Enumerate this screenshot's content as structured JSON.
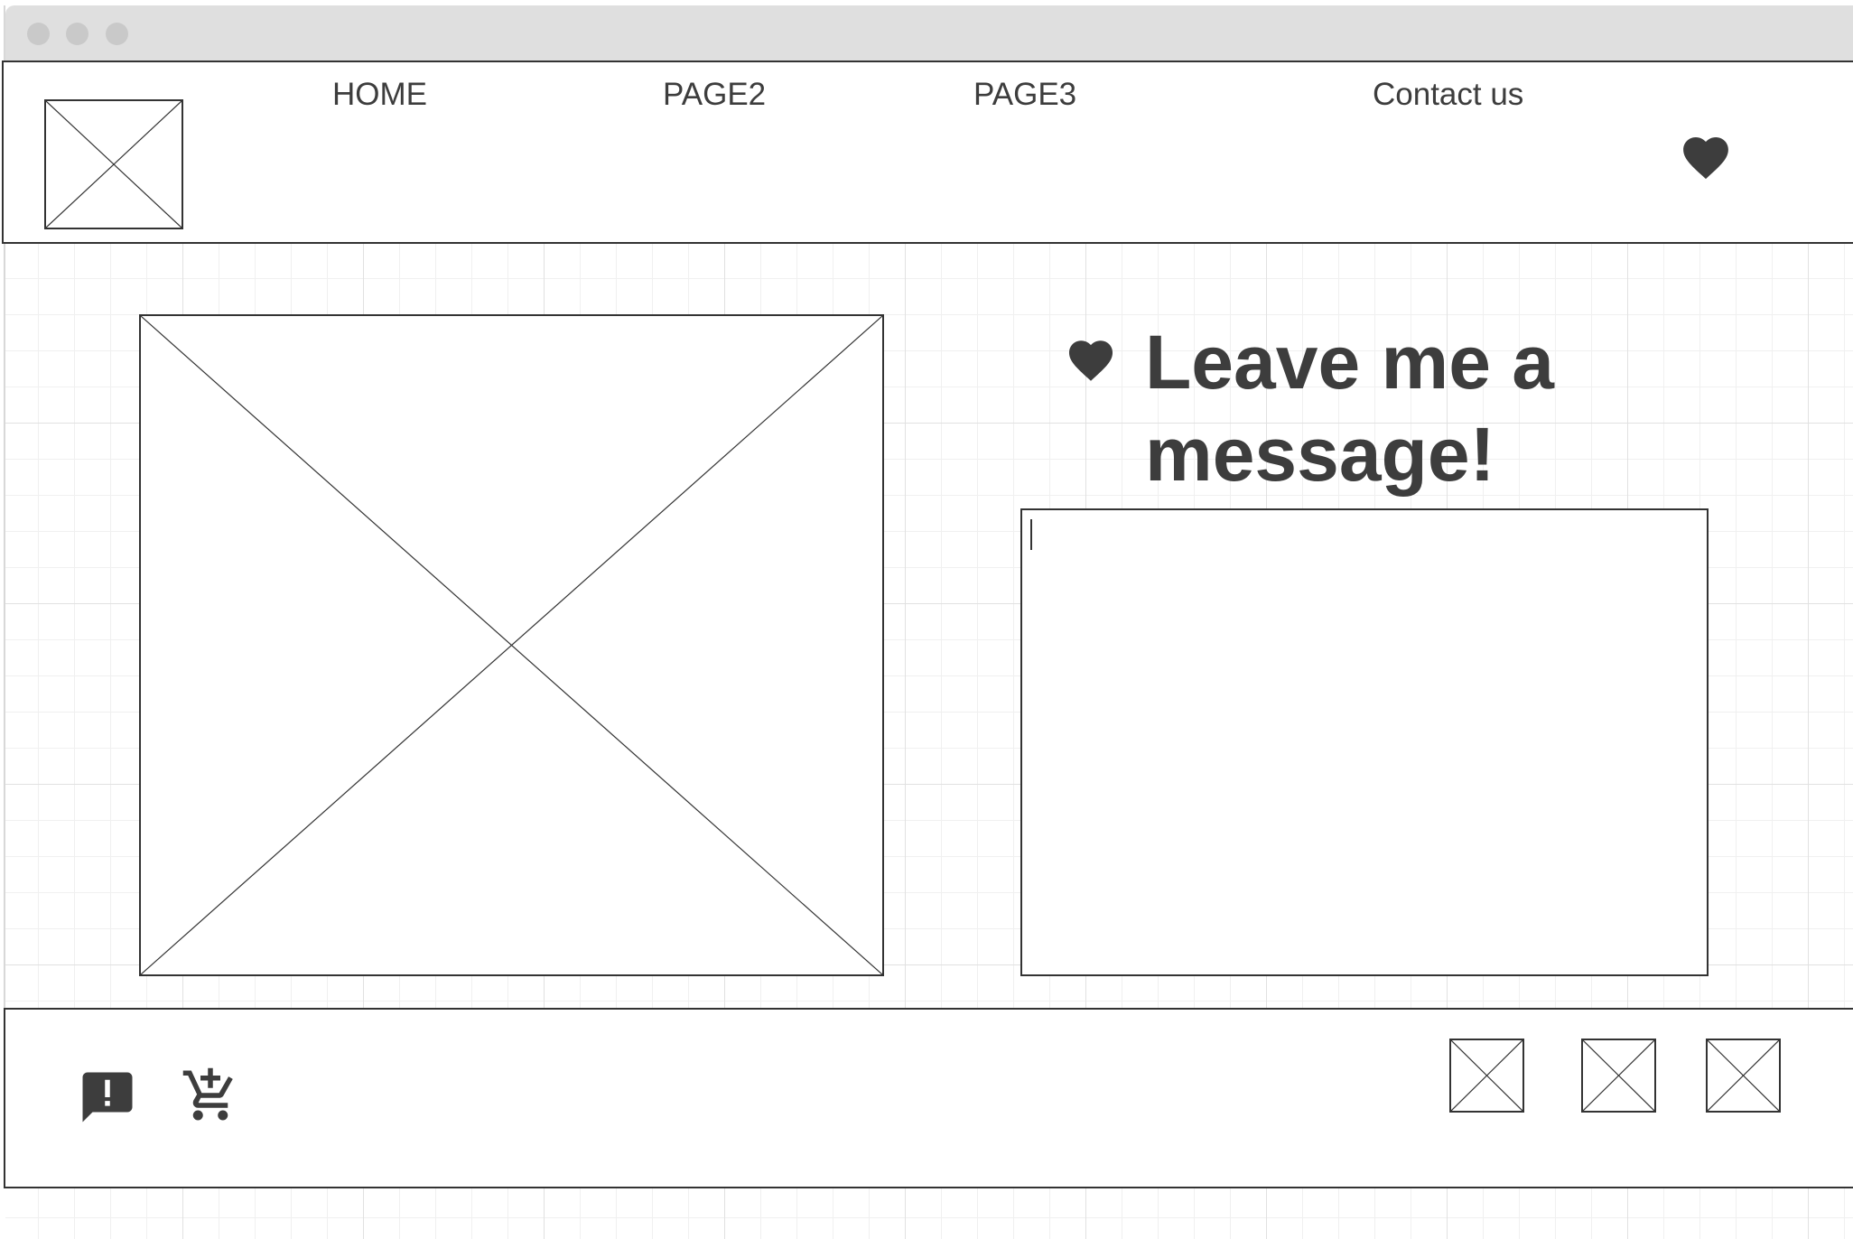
{
  "nav": {
    "items": [
      {
        "label": "HOME"
      },
      {
        "label": "PAGE2"
      },
      {
        "label": "PAGE3"
      },
      {
        "label": "Contact us"
      }
    ]
  },
  "main": {
    "title": "Leave me a message!",
    "message_value": ""
  },
  "icons": {
    "nav_favorite": "heart-icon",
    "title_heart": "heart-icon",
    "feedback": "feedback-icon",
    "cart": "add-to-cart-icon"
  },
  "colors": {
    "ink": "#3d3d3d",
    "border": "#333333",
    "titlebar": "#dfdfdf",
    "grid": "#e1e1e1"
  }
}
